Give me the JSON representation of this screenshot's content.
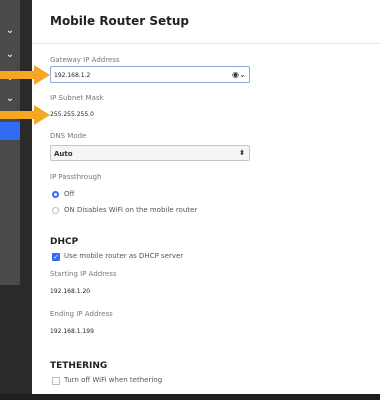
{
  "page_title": "Mobile Router Setup",
  "fields": {
    "gateway_label": "Gateway IP Address",
    "gateway_value": "192.168.1.2",
    "subnet_label": "IP Subnet Mask",
    "subnet_value": "255.255.255.0",
    "dns_label": "DNS Mode",
    "dns_value": "Auto",
    "passthrough_label": "IP Passthrough",
    "passthrough_options": [
      "Off",
      "ON Disables WiFi on the mobile router"
    ],
    "dhcp_title": "DHCP",
    "dhcp_check_label": "Use mobile router as DHCP server",
    "start_label": "Starting IP Address",
    "start_value": "192.168.1.20",
    "end_label": "Ending IP Address",
    "end_value": "192.168.1.199",
    "tethering_title": "TETHERING",
    "tethering_check_label": "Turn off WiFi when tethering"
  },
  "icons": {
    "eye": "eye-icon",
    "dropdown": "chevron-down-icon",
    "sidebar_chevrons": [
      "chevron-down-icon",
      "chevron-down-icon",
      "chevron-down-icon",
      "chevron-down-icon"
    ]
  },
  "colors": {
    "accent": "#2f6df6",
    "arrow": "#f5a623",
    "sidebar": "#4a4a4a"
  }
}
